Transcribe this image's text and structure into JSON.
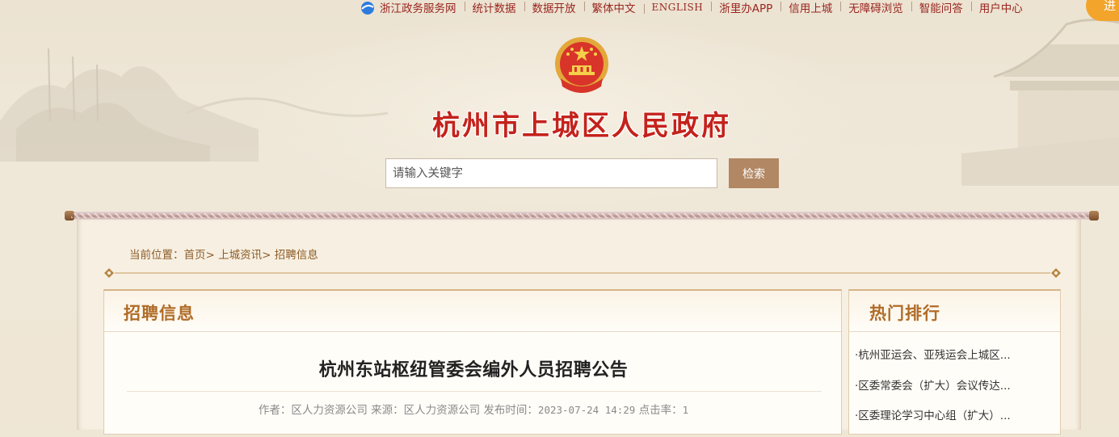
{
  "topnav": {
    "items": [
      {
        "label": "浙江政务服务网"
      },
      {
        "label": "统计数据"
      },
      {
        "label": "数据开放"
      },
      {
        "label": "繁体中文"
      },
      {
        "label": "ENGLISH"
      },
      {
        "label": "浙里办APP"
      },
      {
        "label": "信用上城"
      },
      {
        "label": "无障碍浏览"
      },
      {
        "label": "智能问答"
      },
      {
        "label": "用户中心"
      }
    ],
    "login_label": "进"
  },
  "site": {
    "title": "杭州市上城区人民政府"
  },
  "search": {
    "placeholder": "请输入关键字",
    "button_label": "检索"
  },
  "breadcrumb": {
    "prefix": "当前位置：",
    "items": [
      "首页",
      "上城资讯",
      "招聘信息"
    ],
    "separator": ">"
  },
  "main": {
    "section_title": "招聘信息",
    "article": {
      "title": "杭州东站枢纽管委会编外人员招聘公告",
      "author_label": "作者：",
      "author": "区人力资源公司",
      "source_label": "来源：",
      "source": "区人力资源公司",
      "date_label": "发布时间：",
      "date": "2023-07-24 14:29",
      "clicks_label": "点击率：",
      "clicks": "1"
    }
  },
  "sidebar": {
    "title": "热门排行",
    "items": [
      {
        "label": "·杭州亚运会、亚残运会上城区..."
      },
      {
        "label": "·区委常委会（扩大）会议传达..."
      },
      {
        "label": "·区委理论学习中心组（扩大）..."
      }
    ]
  },
  "colors": {
    "title_red": "#c4221c",
    "nav_red": "#9a2620",
    "accent_brown": "#b06c27",
    "search_button": "#b28763",
    "login_orange": "#f3a42b"
  }
}
